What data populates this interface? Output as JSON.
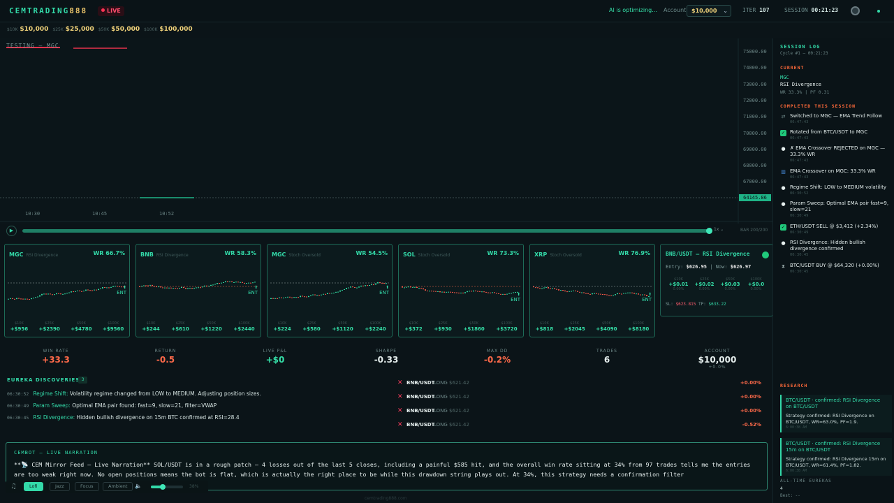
{
  "brand": {
    "part1": "CEMTRADING",
    "part2": "888",
    "live": "LIVE"
  },
  "topbar": {
    "ai_status": "AI is optimizing...",
    "account_label": "Account",
    "account_value": "$10,000",
    "iter_label": "ITER",
    "iter_value": "107",
    "session_label": "SESSION",
    "session_value": "00:21:23"
  },
  "accounts": [
    {
      "small": "$10K",
      "value": "$10,000"
    },
    {
      "small": "$25K",
      "value": "$25,000"
    },
    {
      "small": "$50K",
      "value": "$50,000"
    },
    {
      "small": "$100K",
      "value": "$100,000"
    }
  ],
  "main_chart": {
    "title": "TESTING — MGC",
    "y_ticks": [
      "75000.00",
      "74000.00",
      "73000.00",
      "72000.00",
      "71000.00",
      "70000.00",
      "69000.00",
      "68000.00",
      "67000.00"
    ],
    "current_price": "64145.86",
    "x_ticks": [
      "10:30",
      "10:45",
      "10:52"
    ]
  },
  "scrubber": {
    "speed": "1x",
    "bar_count": "BAR 200/200",
    "progress": 0.99
  },
  "cards": [
    {
      "sym": "MGC",
      "strat": "RSI Divergence",
      "wr": "WR 66.7%",
      "ent": "ENT",
      "pnls": [
        {
          "acct": "$10K",
          "v": "+$956"
        },
        {
          "acct": "$25K",
          "v": "+$2390"
        },
        {
          "acct": "$50K",
          "v": "+$4780"
        },
        {
          "acct": "$100K",
          "v": "+$9560"
        }
      ]
    },
    {
      "sym": "BNB",
      "strat": "RSI Divergence",
      "wr": "WR 58.3%",
      "ent": "ENT",
      "pnls": [
        {
          "acct": "$10K",
          "v": "+$244"
        },
        {
          "acct": "$25K",
          "v": "+$610"
        },
        {
          "acct": "$50K",
          "v": "+$1220"
        },
        {
          "acct": "$100K",
          "v": "+$2440"
        }
      ]
    },
    {
      "sym": "MGC",
      "strat": "Stoch Oversold",
      "wr": "WR 54.5%",
      "ent": "ENT",
      "pnls": [
        {
          "acct": "$10K",
          "v": "+$224"
        },
        {
          "acct": "$25K",
          "v": "+$580"
        },
        {
          "acct": "$50K",
          "v": "+$1120"
        },
        {
          "acct": "$100K",
          "v": "+$2240"
        }
      ]
    },
    {
      "sym": "SOL",
      "strat": "Stoch Oversold",
      "wr": "WR 73.3%",
      "ent": "ENT",
      "pnls": [
        {
          "acct": "$10K",
          "v": "+$372"
        },
        {
          "acct": "$25K",
          "v": "+$930"
        },
        {
          "acct": "$50K",
          "v": "+$1860"
        },
        {
          "acct": "$100K",
          "v": "+$3720"
        }
      ]
    },
    {
      "sym": "XRP",
      "strat": "Stoch Oversold",
      "wr": "WR 76.9%",
      "ent": "ENT",
      "pnls": [
        {
          "acct": "$10K",
          "v": "+$818"
        },
        {
          "acct": "$25K",
          "v": "+$2045"
        },
        {
          "acct": "$50K",
          "v": "+$4090"
        },
        {
          "acct": "$100K",
          "v": "+$8180"
        }
      ]
    }
  ],
  "bnb_panel": {
    "title": "BNB/USDT — RSI Divergence",
    "entry_label": "Entry:",
    "entry": "$626.95",
    "now_label": "Now:",
    "now": "$626.97",
    "pnls": [
      {
        "acct": "$10K",
        "v": "+$0.01",
        "pct": "0.00%"
      },
      {
        "acct": "$25K",
        "v": "+$0.02",
        "pct": "0.00%"
      },
      {
        "acct": "$50K",
        "v": "+$0.03",
        "pct": "0.00%"
      },
      {
        "acct": "$100K",
        "v": "+$0.0",
        "pct": "0.00%"
      }
    ],
    "sl_label": "SL:",
    "sl": "$623.815",
    "tp_label": "TP:",
    "tp": "$633.22"
  },
  "stats": {
    "win_rate": {
      "label": "WIN RATE",
      "value": "+33.3"
    },
    "return": {
      "label": "RETURN",
      "value": "-0.5"
    },
    "live_pnl": {
      "label": "LIVE P&L",
      "value": "+$0"
    },
    "sharpe": {
      "label": "SHARPE",
      "value": "-0.33"
    },
    "max_dd": {
      "label": "MAX DD",
      "value": "-0.2%"
    },
    "trades": {
      "label": "TRADES",
      "value": "6"
    },
    "account": {
      "label": "ACCOUNT",
      "value": "$10,000",
      "sub": "+0.0%"
    }
  },
  "eureka": {
    "title": "EUREKA DISCOVERIES",
    "count": "3",
    "items": [
      {
        "time": "06:30:52",
        "kind": "Regime Shift:",
        "text": "Volatility regime changed from LOW to MEDIUM. Adjusting position sizes."
      },
      {
        "time": "06:30:49",
        "kind": "Param Sweep:",
        "text": "Optimal EMA pair found: fast=9, slow=21, filter=VWAP"
      },
      {
        "time": "06:30:45",
        "kind": "RSI Divergence:",
        "text": "Hidden bullish divergence on 15m BTC confirmed at RSI=28.4"
      }
    ]
  },
  "trades": [
    {
      "sym": "BNB/USDT",
      "side": "LONG",
      "px": "$621.42",
      "pl": "+0.00%"
    },
    {
      "sym": "BNB/USDT",
      "side": "LONG",
      "px": "$621.42",
      "pl": "+0.00%"
    },
    {
      "sym": "BNB/USDT",
      "side": "LONG",
      "px": "$621.42",
      "pl": "+0.00%"
    },
    {
      "sym": "BNB/USDT",
      "side": "LONG",
      "px": "$621.42",
      "pl": "-0.52%"
    }
  ],
  "narration": {
    "title": "CEMBOT — LIVE NARRATION",
    "text": "**📡 CEM Mirror Feed — Live Narration** SOL/USDT is in a rough patch — 4 losses out of the last 5 closes, including a painful $585 hit, and the overall win rate sitting at 34% from 97 trades tells me the entries are too weak right now. No open positions means the bot is flat, which is actually the right place to be while this drawdown string plays out. At 34%, this strategy needs a confirmation filter"
  },
  "music": {
    "buttons": [
      "Lofi",
      "Jazz",
      "Focus",
      "Ambient"
    ],
    "active": "Lofi",
    "volume_pct": "38%",
    "volume": 0.38
  },
  "sidebar": {
    "title": "SESSION LOG",
    "cycle": "Cycle #1 — 00:21:23",
    "current_h": "CURRENT",
    "current_sym": "MGC",
    "current_strat": "RSI Divergence",
    "current_stats": "WR 33.3% | PF 0.31",
    "completed_h": "COMPLETED THIS SESSION",
    "log": [
      {
        "icon": "switch-icon",
        "glyph": "⇄",
        "color": "#6c8686",
        "text": "Switched to MGC — EMA Trend Follow",
        "time": "06:47:43"
      },
      {
        "icon": "check-icon",
        "glyph": "✓",
        "color": "#20c97b",
        "text": "Rotated from BTC/USDT to MGC",
        "time": "06:47:43"
      },
      {
        "icon": "bulb-icon",
        "glyph": "●",
        "color": "#e6efee",
        "text": "✗ EMA Crossover REJECTED on MGC — 33.3% WR",
        "time": "06:47:43"
      },
      {
        "icon": "chart-icon",
        "glyph": "▥",
        "color": "#4a90e2",
        "text": "EMA Crossover on MGC: 33.3% WR",
        "time": "06:47:43"
      },
      {
        "icon": "bulb-icon",
        "glyph": "●",
        "color": "#e6efee",
        "text": "Regime Shift: LOW to MEDIUM volatility",
        "time": "06:30:52"
      },
      {
        "icon": "bulb-icon",
        "glyph": "●",
        "color": "#e6efee",
        "text": "Param Sweep: Optimal EMA pair fast=9, slow=21",
        "time": "06:30:49"
      },
      {
        "icon": "check-icon",
        "glyph": "✓",
        "color": "#20c97b",
        "text": "ETH/USDT SELL @ $3,412 (+2.34%)",
        "time": "06:30:49"
      },
      {
        "icon": "bulb-icon",
        "glyph": "●",
        "color": "#e6efee",
        "text": "RSI Divergence: Hidden bullish divergence confirmed",
        "time": "06:30:45"
      },
      {
        "icon": "hourglass-icon",
        "glyph": "⧗",
        "color": "#9aa",
        "text": "BTC/USDT BUY @ $64,320 (+0.00%)",
        "time": "06:30:45"
      }
    ],
    "research_h": "RESEARCH",
    "research": [
      {
        "head": "BTC/USDT · confirmed: RSI Divergence on BTC/USDT",
        "body": "Strategy confirmed: RSI Divergence on BTC/USDT, WR=63.0%, PF=1.9.",
        "time": "6:00:38 AM"
      },
      {
        "head": "BTC/USDT · confirmed: RSI Divergence 15m on BTC/USDT",
        "body": "Strategy confirmed: RSI Divergence 15m on BTC/USDT, WR=61.4%, PF=1.82.",
        "time": "6:00:38 AM"
      }
    ],
    "alltime_h": "ALL-TIME EUREKAS",
    "alltime_v": "4",
    "best": "Best: --"
  },
  "footer_url": "cemtrading888.com",
  "colors": {
    "accent": "#33d9a8",
    "gold": "#f0d27a",
    "negative": "#ff6a4a",
    "bg": "#0b1418"
  }
}
